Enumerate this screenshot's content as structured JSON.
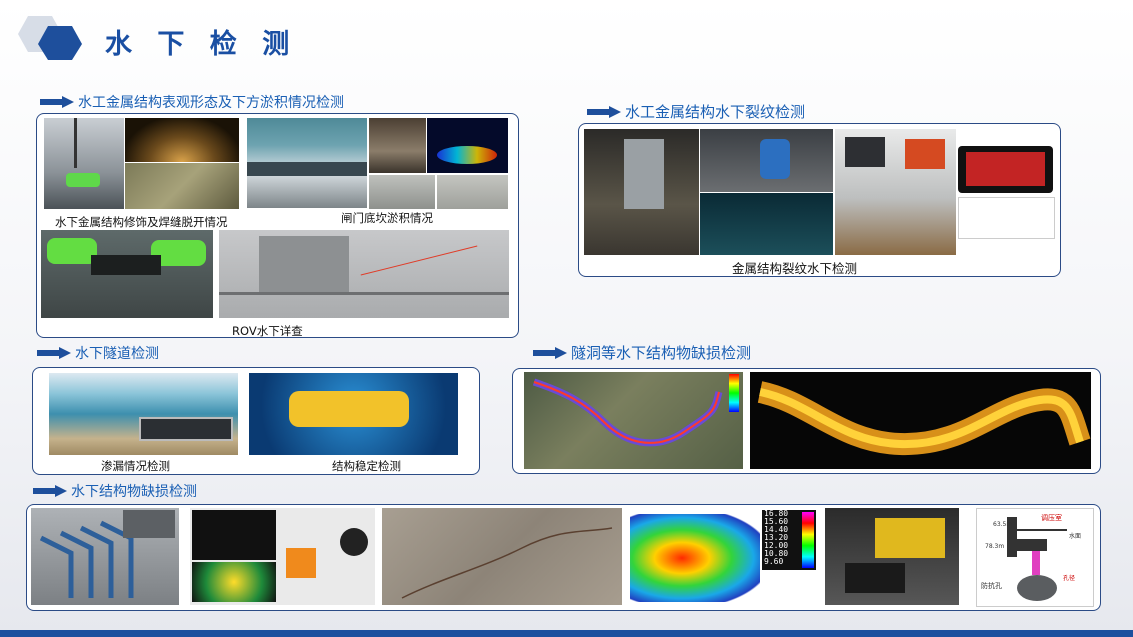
{
  "header": {
    "title": "水 下 检 测"
  },
  "sections": {
    "metal_surface": {
      "title": "水工金属结构表观形态及下方淤积情况检测",
      "captions": [
        "水下金属结构修饰及焊缝脱开情况",
        "闸门底坎淤积情况",
        "ROV水下详查"
      ]
    },
    "crack": {
      "title": "水工金属结构水下裂纹检测",
      "caption": "金属结构裂纹水下检测"
    },
    "tunnel": {
      "title": "水下隧道检测",
      "captions": [
        "渗漏情况检测",
        "结构稳定检测"
      ]
    },
    "tunnel_defect": {
      "title": "隧洞等水下结构物缺损检测"
    },
    "structure_defect": {
      "title": "水下结构物缺损检测",
      "legend_values": [
        "16.80",
        "15.60",
        "14.40",
        "13.20",
        "12.00",
        "10.80",
        "9.60"
      ],
      "diagram_labels": {
        "top_right": "调压室",
        "water": "水面",
        "elev_top": "63.5m",
        "elev_mid": "78.3m",
        "side": "防抗孔",
        "bottom_red": "孔径"
      }
    }
  }
}
